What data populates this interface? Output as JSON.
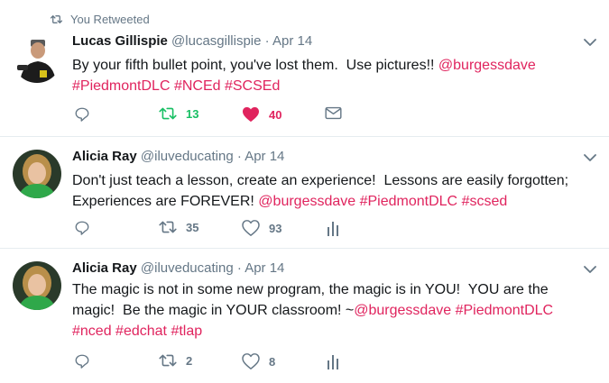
{
  "tweets": [
    {
      "retweet_context": "You Retweeted",
      "author_name": "Lucas Gillispie",
      "handle": "@lucasgillispie",
      "separator": " · ",
      "date": "Apr 14",
      "lines": [
        [
          {
            "t": "By your fifth bullet point, you've lost them.  Use pictures!! ",
            "l": false
          },
          {
            "t": "@burgessdave",
            "l": true
          }
        ],
        [
          {
            "t": "#PiedmontDLC",
            "l": true
          },
          {
            "t": " ",
            "l": false
          },
          {
            "t": "#NCEd",
            "l": true
          },
          {
            "t": " ",
            "l": false
          },
          {
            "t": "#SCSEd",
            "l": true
          }
        ]
      ],
      "retweets": "13",
      "likes": "40",
      "retweeted": true,
      "liked": true,
      "third_action_icon": "envelope-icon"
    },
    {
      "author_name": "Alicia Ray",
      "handle": "@iluveducating",
      "separator": " · ",
      "date": "Apr 14",
      "lines": [
        [
          {
            "t": "Don't just teach a lesson, create an experience!  Lessons are easily forgotten;",
            "l": false
          }
        ],
        [
          {
            "t": "Experiences are FOREVER! ",
            "l": false
          },
          {
            "t": "@burgessdave",
            "l": true
          },
          {
            "t": " ",
            "l": false
          },
          {
            "t": "#PiedmontDLC",
            "l": true
          },
          {
            "t": " ",
            "l": false
          },
          {
            "t": "#scsed",
            "l": true
          }
        ]
      ],
      "retweets": "35",
      "likes": "93",
      "retweeted": false,
      "liked": false,
      "third_action_icon": "analytics-icon"
    },
    {
      "author_name": "Alicia Ray",
      "handle": "@iluveducating",
      "separator": " · ",
      "date": "Apr 14",
      "lines": [
        [
          {
            "t": "The magic is not in some new program, the magic is in YOU!  YOU are the",
            "l": false
          }
        ],
        [
          {
            "t": "magic!  Be the magic in YOUR classroom! ~",
            "l": false
          },
          {
            "t": "@burgessdave",
            "l": true
          },
          {
            "t": " ",
            "l": false
          },
          {
            "t": "#PiedmontDLC",
            "l": true
          }
        ],
        [
          {
            "t": "#nced",
            "l": true
          },
          {
            "t": " ",
            "l": false
          },
          {
            "t": "#edchat",
            "l": true
          },
          {
            "t": " ",
            "l": false
          },
          {
            "t": "#tlap",
            "l": true
          }
        ]
      ],
      "retweets": "2",
      "likes": "8",
      "retweeted": false,
      "liked": false,
      "third_action_icon": "analytics-icon"
    }
  ],
  "colors": {
    "link": "#e0245e",
    "retweet_active": "#17bf63",
    "like_active": "#e0245e",
    "muted": "#657786",
    "divider": "#e6ecf0"
  }
}
